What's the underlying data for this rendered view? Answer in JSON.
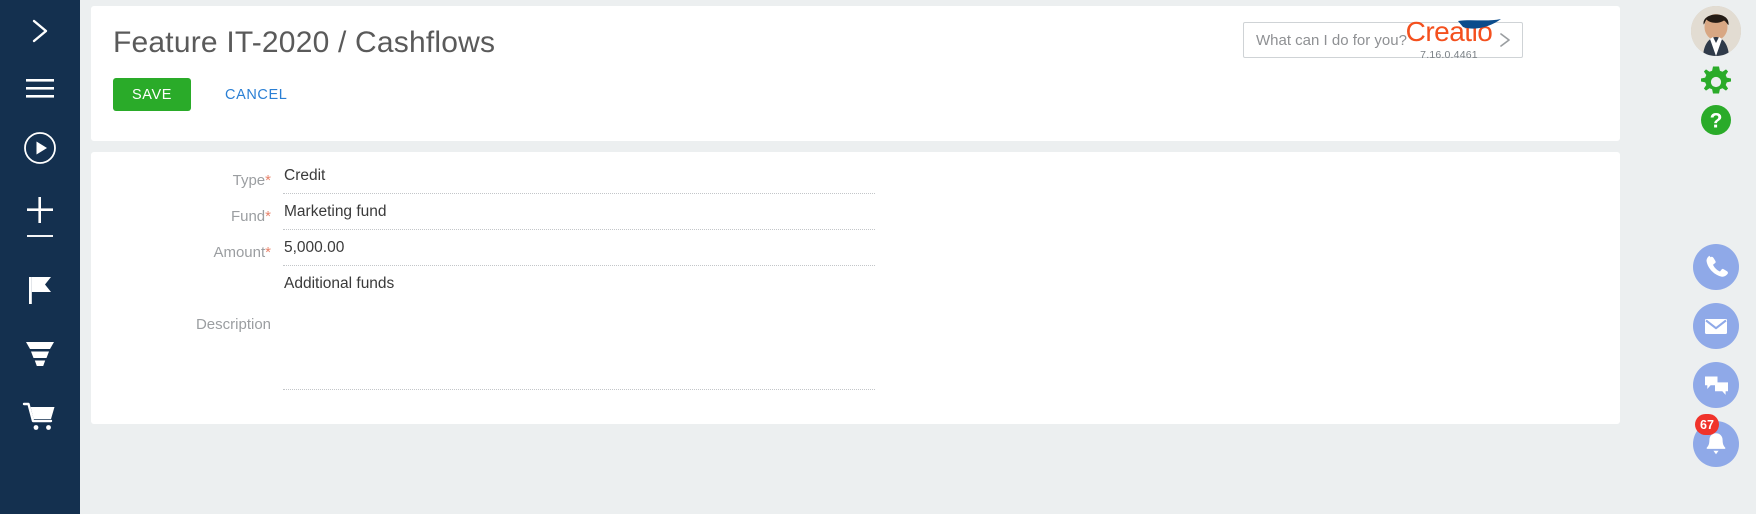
{
  "colors": {
    "left_nav_bg": "#14304f",
    "page_bg": "#eceff0",
    "card_bg": "#ffffff",
    "accent_green": "#2aab29",
    "link_blue": "#2a7fd4",
    "brand_orange": "#f4501e",
    "brand_navy": "#0b4c8c",
    "required_star": "#e8836b",
    "rail_icon_blue": "#8fa9e8",
    "badge_red": "#f0332b",
    "help_green": "#2aab29"
  },
  "left_nav": {
    "items": [
      {
        "name": "expand-menu-icon",
        "icon": "chevron-right",
        "label": "Expand menu"
      },
      {
        "name": "main-menu-icon",
        "icon": "hamburger",
        "label": "Main menu"
      },
      {
        "name": "run-process-icon",
        "icon": "play-circle",
        "label": "Run process"
      },
      {
        "name": "add-record-icon",
        "icon": "plus",
        "label": "Add"
      },
      {
        "name": "campaigns-icon",
        "icon": "flag",
        "label": "Campaigns"
      },
      {
        "name": "funnel-icon",
        "icon": "funnel",
        "label": "Sales pipeline"
      },
      {
        "name": "orders-icon",
        "icon": "shopping-cart",
        "label": "Orders"
      }
    ]
  },
  "header": {
    "title": "Feature IT-2020 / Cashflows",
    "save_label": "SAVE",
    "cancel_label": "CANCEL"
  },
  "search": {
    "placeholder": "What can I do for you?",
    "value": "",
    "submit_icon": "chevron-right-icon"
  },
  "logo": {
    "wordmark": "Creatio",
    "version": "7.16.0.4461"
  },
  "form": {
    "fields": [
      {
        "label": "Type",
        "required": true,
        "value": "Credit",
        "name": "type"
      },
      {
        "label": "Fund",
        "required": true,
        "value": "Marketing fund",
        "name": "fund"
      },
      {
        "label": "Amount",
        "required": true,
        "value": "5,000.00",
        "name": "amount"
      },
      {
        "label": "Description",
        "required": false,
        "value": "Additional funds",
        "name": "description"
      }
    ]
  },
  "right_rail": {
    "avatar_label": "User profile",
    "items": [
      {
        "name": "settings-gear-icon",
        "icon": "gear",
        "label": "Settings"
      },
      {
        "name": "help-icon",
        "icon": "question",
        "label": "Help"
      },
      {
        "name": "phone-icon",
        "icon": "phone",
        "label": "Calls"
      },
      {
        "name": "email-icon",
        "icon": "envelope",
        "label": "Email"
      },
      {
        "name": "chat-icon",
        "icon": "chat",
        "label": "Chats"
      },
      {
        "name": "notifications-icon",
        "icon": "bell",
        "label": "Notifications"
      }
    ],
    "notification_count": "67"
  }
}
